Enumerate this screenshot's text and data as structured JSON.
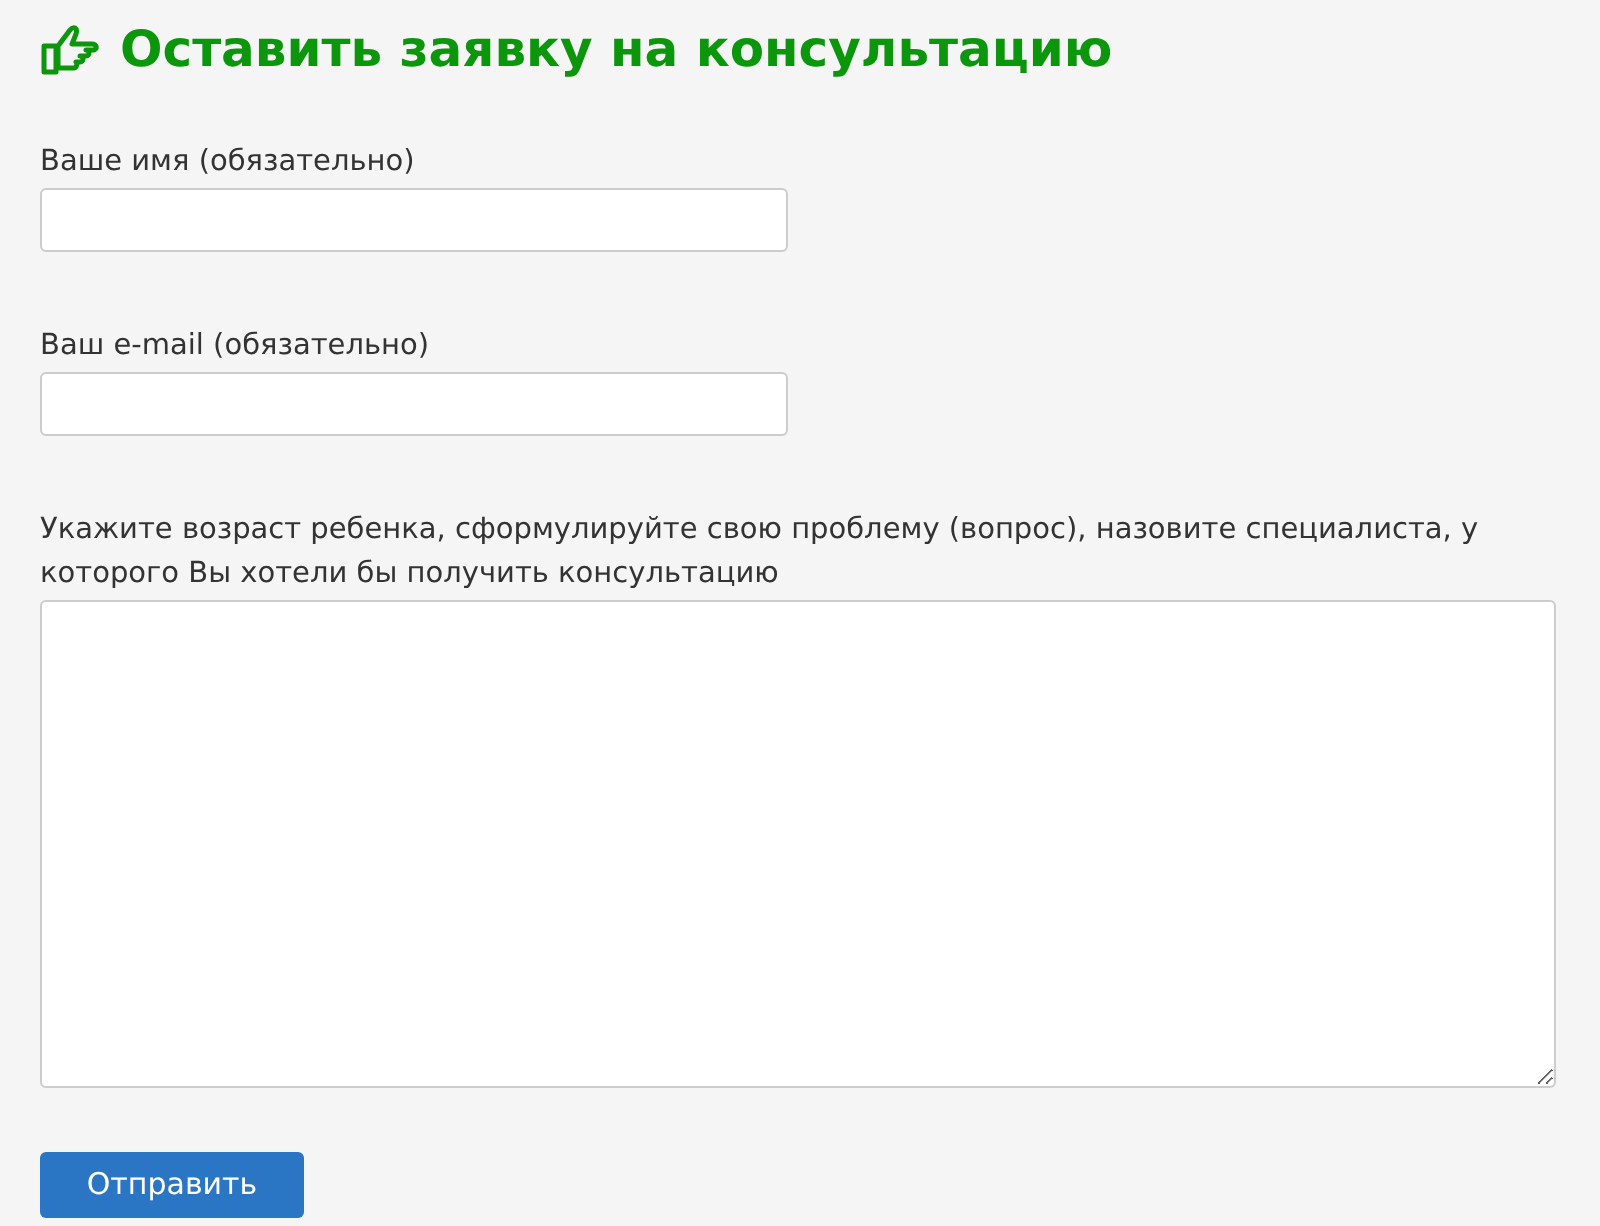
{
  "title": "Оставить заявку на консультацию",
  "fields": [
    {
      "kind": "input",
      "label": "Ваше имя (обязательно)"
    },
    {
      "kind": "input",
      "label": "Ваш e-mail (обязательно)"
    },
    {
      "kind": "textarea",
      "label": "Укажите возраст ребенка, сформулируйте свою проблему (вопрос), назовите специалиста, у которого Вы хотели бы получить консультацию"
    }
  ],
  "submit": "Отправить"
}
